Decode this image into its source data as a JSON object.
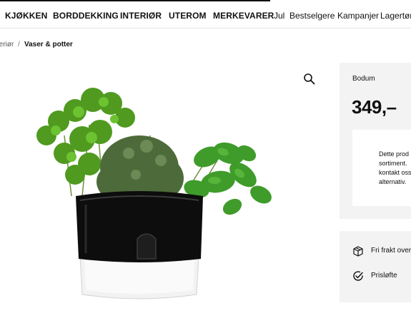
{
  "nav": {
    "items": [
      "KJØKKEN",
      "BORDDEKKING",
      "INTERIØR",
      "UTEROM",
      "MERKEVARER",
      "Jul",
      "Bestselgere",
      "Kampanjer",
      "Lagertøm"
    ]
  },
  "breadcrumb": {
    "previous": "teriør",
    "separator": "/",
    "current": "Vaser & potter"
  },
  "product": {
    "brand": "Bodum",
    "price": "349,–",
    "notice_lines": [
      "Dette prod",
      "sortiment.",
      "kontakt oss",
      "alternativ."
    ],
    "usps": [
      {
        "icon": "box-icon",
        "label": "Fri frakt over"
      },
      {
        "icon": "check-circle-icon",
        "label": "Prisløfte"
      }
    ]
  },
  "colors": {
    "text": "#111111",
    "panel_bg": "#f3f3f3",
    "pot_black": "#0d0d0d",
    "pot_glass": "#f4f4f4"
  }
}
